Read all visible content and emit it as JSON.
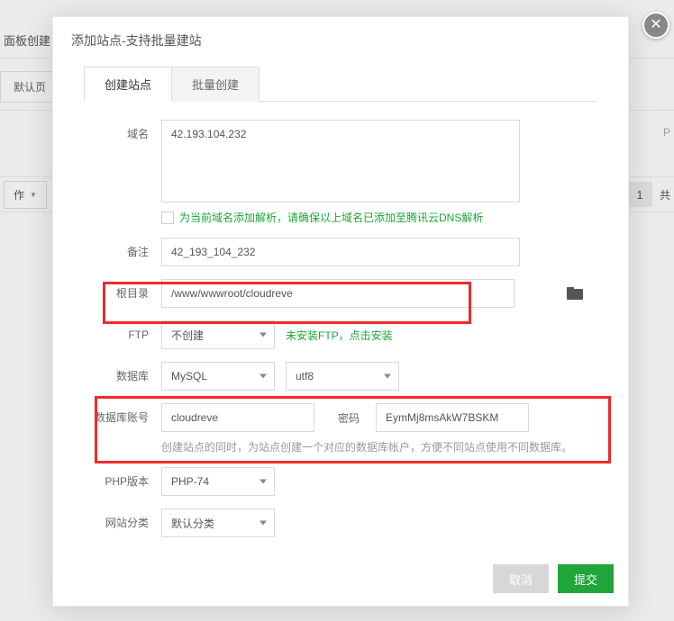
{
  "bg": {
    "topbar_text": "面板创建",
    "nav_default": "默认页",
    "op_label": "作",
    "page_number": "1",
    "page_total_prefix": "共",
    "p_label": "P"
  },
  "modal": {
    "title": "添加站点-支持批量建站",
    "tabs": {
      "single": "创建站点",
      "batch": "批量创建"
    },
    "form": {
      "domain": {
        "label": "域名",
        "value": "42.193.104.232",
        "dns_checkbox_label": "为当前域名添加解析，请确保以上域名已添加至腾讯云DNS解析"
      },
      "remark": {
        "label": "备注",
        "value": "42_193_104_232"
      },
      "root": {
        "label": "根目录",
        "value": "/www/wwwroot/cloudreve"
      },
      "ftp": {
        "label": "FTP",
        "value": "不创建",
        "hint": "未安装FTP，点击安装"
      },
      "database": {
        "label": "数据库",
        "engine": "MySQL",
        "charset": "utf8"
      },
      "db_account": {
        "label": "数据库账号",
        "user": "cloudreve",
        "pass_label": "密码",
        "pass": "EymMj8msAkW7BSKM",
        "hint": "创建站点的同时，为站点创建一个对应的数据库帐户，方便不同站点使用不同数据库。"
      },
      "php": {
        "label": "PHP版本",
        "value": "PHP-74"
      },
      "category": {
        "label": "网站分类",
        "value": "默认分类"
      }
    },
    "footer": {
      "cancel": "取消",
      "submit": "提交"
    }
  }
}
